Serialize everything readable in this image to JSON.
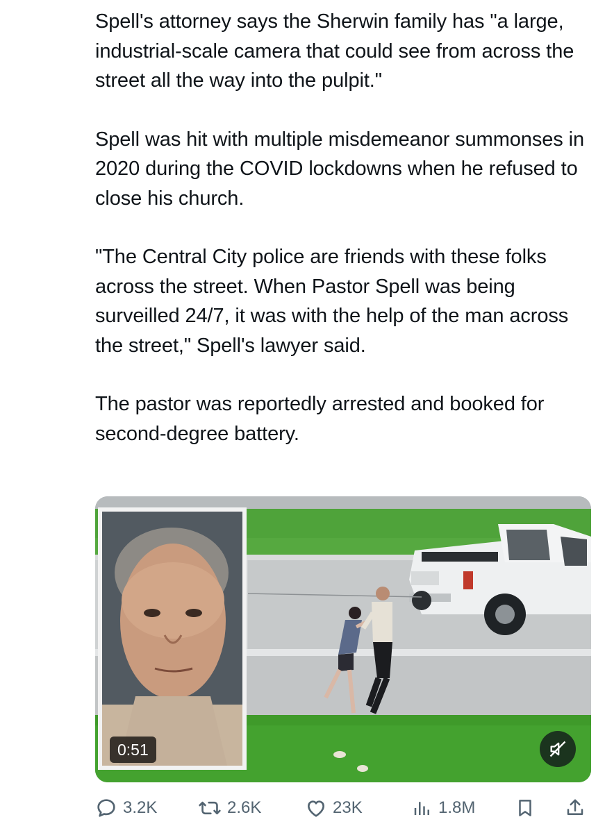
{
  "tweet": {
    "paragraphs": [
      "Spell's attorney says the Sherwin family has \"a large, industrial-scale camera that could see from across the street all the way into the pulpit.\"",
      "Spell was hit with multiple misdemeanor summonses in 2020 during the COVID lockdowns when he refused to close his church.",
      "\"The Central City police are friends with these folks across the street. When Pastor Spell was being surveilled 24/7, it was with the help of the man across the street,\" Spell's lawyer said.",
      "The pastor was reportedly arrested and booked for second-degree battery."
    ]
  },
  "media": {
    "type": "video",
    "duration": "0:51",
    "muted": true,
    "mute_icon": "speaker-muted-icon"
  },
  "actions": {
    "replies": {
      "icon": "reply-icon",
      "count": "3.2K"
    },
    "reposts": {
      "icon": "repost-icon",
      "count": "2.6K"
    },
    "likes": {
      "icon": "heart-icon",
      "count": "23K"
    },
    "views": {
      "icon": "analytics-icon",
      "count": "1.8M"
    },
    "bookmark": {
      "icon": "bookmark-icon"
    },
    "share": {
      "icon": "share-icon"
    }
  },
  "colors": {
    "text": "#0f1419",
    "secondary": "#536471",
    "grass": "#3f9a2a",
    "pavement": "#c9cccd"
  }
}
